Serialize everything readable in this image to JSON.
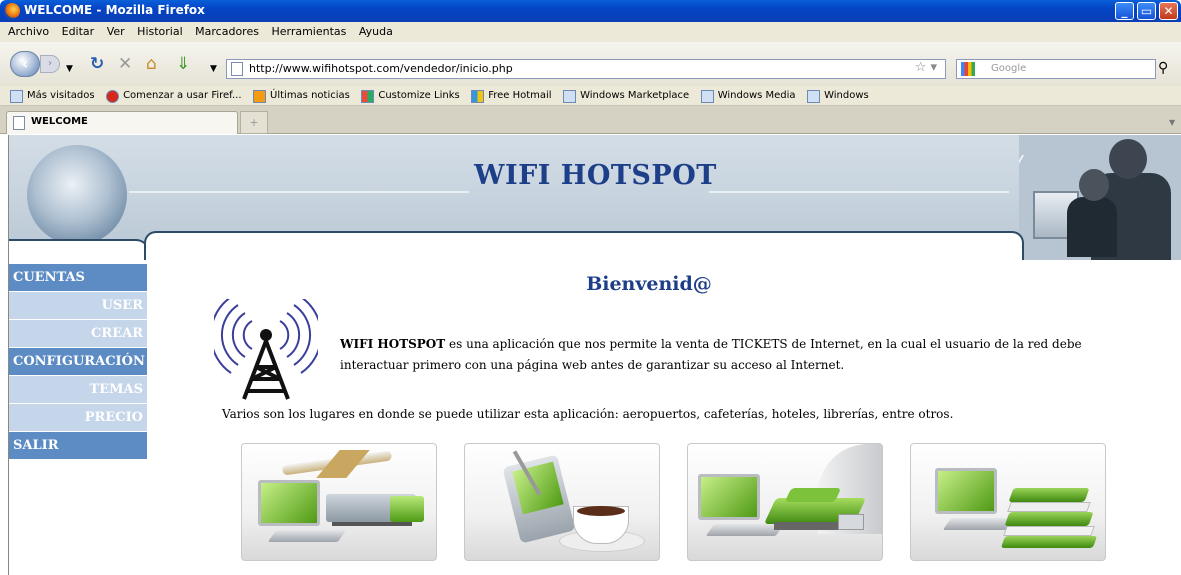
{
  "window": {
    "title": "WELCOME - Mozilla Firefox",
    "controls": {
      "minimize": "_",
      "maximize": "▭",
      "close": "✕"
    }
  },
  "menu": [
    "Archivo",
    "Editar",
    "Ver",
    "Historial",
    "Marcadores",
    "Herramientas",
    "Ayuda"
  ],
  "nav": {
    "url": "http://www.wifihotspot.com/vendedor/inicio.php",
    "search_placeholder": "Google"
  },
  "bookmarks": [
    "Más visitados",
    "Comenzar a usar Firef...",
    "Últimas noticias",
    "Customize Links",
    "Free Hotmail",
    "Windows Marketplace",
    "Windows Media",
    "Windows"
  ],
  "tabs": {
    "active": "WELCOME",
    "new_tab": "+"
  },
  "page": {
    "site_title": "WIFI HOTSPOT",
    "welcome": "Bienvenid@",
    "sidebar": [
      {
        "label": "CUENTAS",
        "level": "main"
      },
      {
        "label": "USER",
        "level": "sub"
      },
      {
        "label": "CREAR",
        "level": "sub"
      },
      {
        "label": "CONFIGURACIÓN",
        "level": "main"
      },
      {
        "label": "TEMAS",
        "level": "sub"
      },
      {
        "label": "PRECIO",
        "level": "sub"
      },
      {
        "label": "SALIR",
        "level": "main"
      }
    ],
    "intro_brand": "WIFI HOTSPOT",
    "intro_text": "es una aplicación que nos permite la venta de TICKETS de Internet, en la cual el usuario de la red debe interactuar primero con una página web antes de garantizar su acceso al Internet.",
    "places_text": "Varios son los lugares en donde se puede utilizar esta aplicación: aeropuertos, cafeterías, hoteles, librerías, entre otros.",
    "cards": [
      "airport",
      "cafe",
      "hotel",
      "library"
    ]
  },
  "colors": {
    "title_blue": "#1d3e88",
    "sidebar_main": "#5d8cc5",
    "sidebar_sub": "#c6d6ea",
    "laptop_green": "#4f9a14"
  }
}
